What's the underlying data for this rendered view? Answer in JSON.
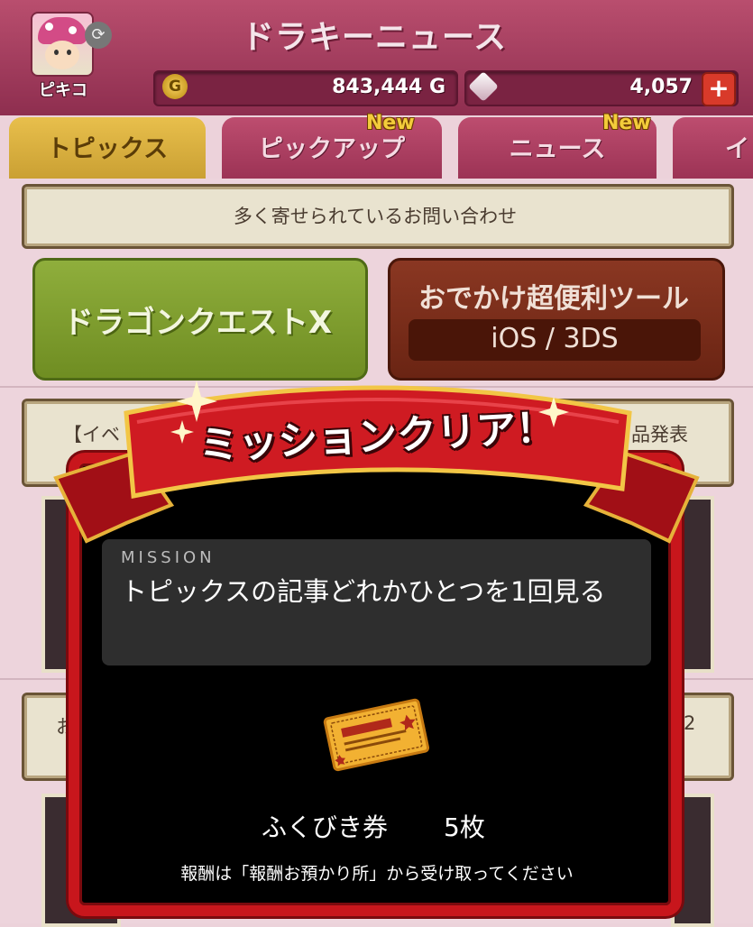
{
  "header": {
    "title": "ドラキーニュース",
    "player_name": "ピキコ",
    "gold_value": "843,444 G",
    "gold_icon": "G",
    "gem_value": "4,057",
    "gem_add": "+"
  },
  "tabs": [
    {
      "label": "トピックス",
      "active": true
    },
    {
      "label": "ピックアップ",
      "new": "New"
    },
    {
      "label": "ニュース",
      "new": "New"
    },
    {
      "label": "イ"
    }
  ],
  "content": {
    "inquiries": "多く寄せられているお問い合わせ",
    "dq_button": "ドラゴンクエストX",
    "tool_title": "おでかけ超便利ツール",
    "tool_sub": "iOS / 3DS",
    "event_left": "【イベ",
    "event_right": "品発表",
    "banner2_left": "お",
    "banner2_right": "2"
  },
  "modal": {
    "title": "ミッションクリア！",
    "mission_label": "MISSION",
    "mission_text": "トピックスの記事どれかひとつを1回見る",
    "reward_name": "ふくびき券",
    "reward_count": "5枚",
    "reward_note": "報酬は「報酬お預かり所」から受け取ってください"
  },
  "colors": {
    "header": "#a13d5f",
    "active_tab": "#dcb543",
    "modal_border": "#c8161c",
    "ribbon": "#c8161c"
  }
}
